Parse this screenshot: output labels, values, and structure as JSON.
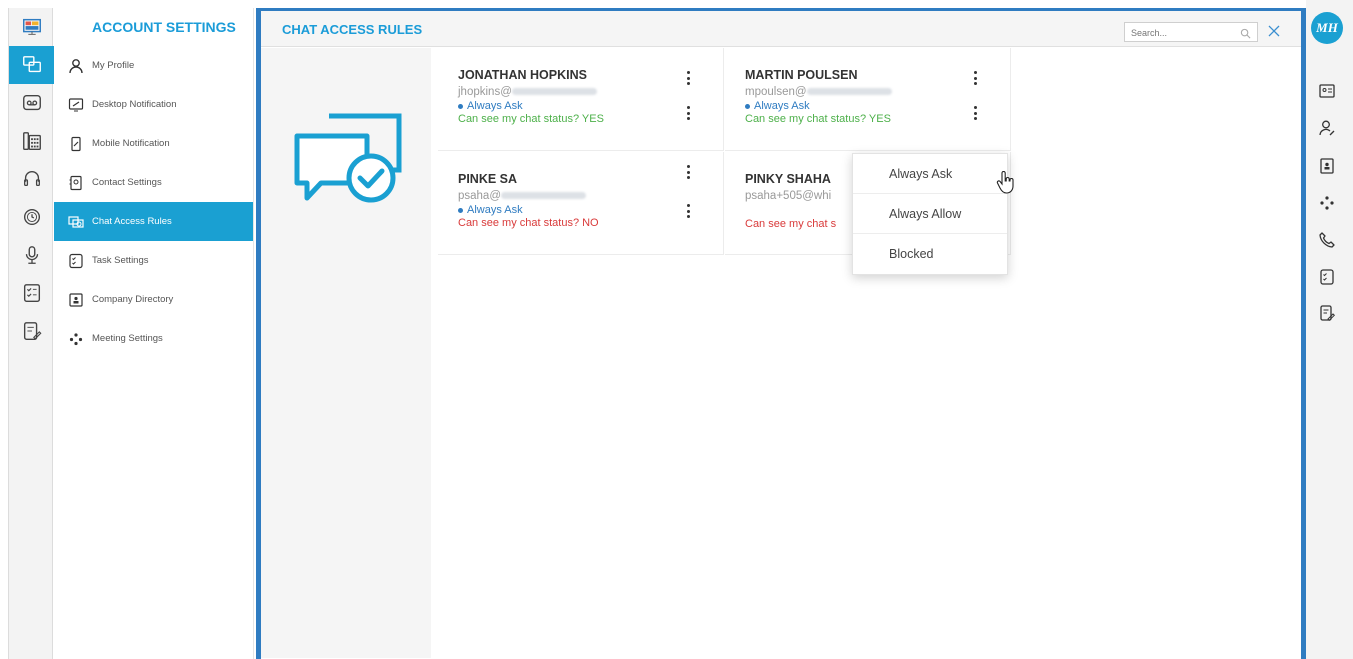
{
  "nav": {
    "title": "ACCOUNT SETTINGS",
    "items": [
      {
        "label": "My Profile",
        "icon": "user-icon"
      },
      {
        "label": "Desktop Notification",
        "icon": "desktop-notification-icon"
      },
      {
        "label": "Mobile Notification",
        "icon": "mobile-notification-icon"
      },
      {
        "label": "Contact Settings",
        "icon": "contact-settings-icon"
      },
      {
        "label": "Chat Access Rules",
        "icon": "chat-access-icon",
        "active": true
      },
      {
        "label": "Task Settings",
        "icon": "task-icon"
      },
      {
        "label": "Company Directory",
        "icon": "directory-icon"
      },
      {
        "label": "Meeting Settings",
        "icon": "meeting-icon"
      }
    ]
  },
  "main": {
    "title": "CHAT ACCESS RULES",
    "search_placeholder": "Search..."
  },
  "contacts": [
    {
      "name": "JONATHAN HOPKINS",
      "email": "jhopkins@",
      "preference": "Always Ask",
      "status": "Can see my chat status? YES",
      "status_ok": true
    },
    {
      "name": "MARTIN POULSEN",
      "email": "mpoulsen@",
      "preference": "Always Ask",
      "status": "Can see my chat status? YES",
      "status_ok": true
    },
    {
      "name": "PINKE SA",
      "email": "psaha@",
      "preference": "Always Ask",
      "status": "Can see my chat status? NO",
      "status_ok": false
    },
    {
      "name": "PINKY SHAHA",
      "email": "psaha+505@whi",
      "preference": "",
      "status": "Can see my chat s",
      "status_ok": false
    }
  ],
  "dropdown": {
    "options": [
      "Always Ask",
      "Always Allow",
      "Blocked"
    ]
  },
  "user": {
    "initials": "MH"
  },
  "colors": {
    "accent": "#1aa0d2",
    "frame": "#2f7cc1",
    "yes": "#4db04a",
    "no": "#d93a3a"
  }
}
